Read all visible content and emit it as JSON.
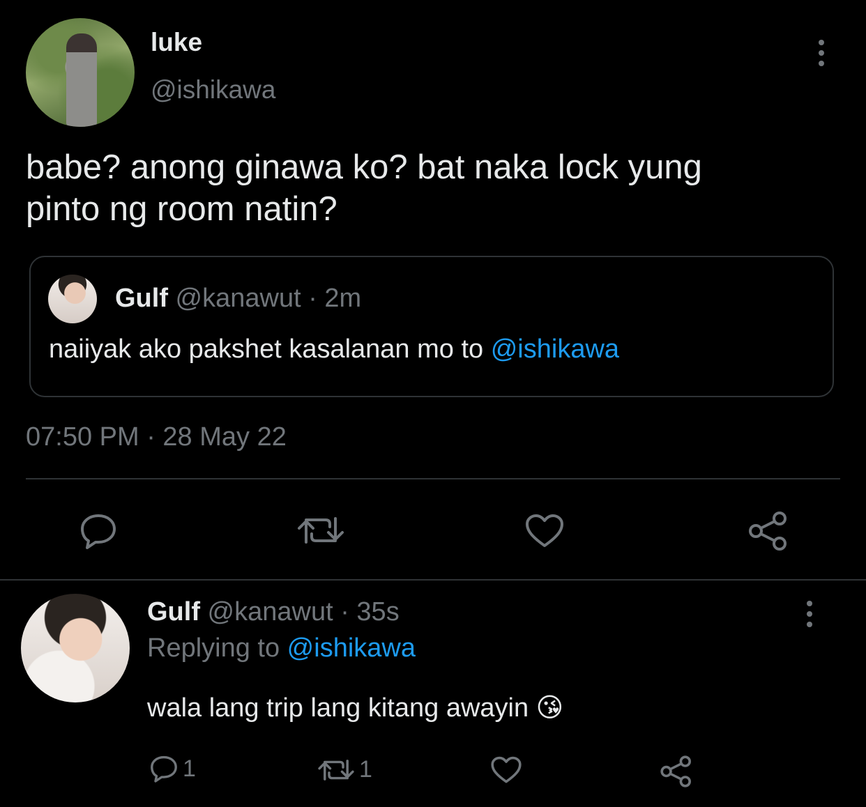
{
  "main_tweet": {
    "display_name": "luke",
    "handle": "@ishikawa",
    "text_line1": "babe? anong ginawa ko? bat naka lock yung",
    "text_line2": "pinto ng room natin?",
    "timestamp": "07:50 PM · 28 May 22"
  },
  "quoted_tweet": {
    "display_name": "Gulf",
    "handle_time": "@kanawut · 2m",
    "text": "naiiyak ako pakshet kasalanan mo to ",
    "mention": "@ishikawa"
  },
  "reply_tweet": {
    "display_name": "Gulf",
    "handle_time": "@kanawut · 35s",
    "replying_prefix": "Replying to ",
    "replying_mention": "@ishikawa",
    "text": "wala lang trip lang kitang awayin",
    "emoji": "😘",
    "reply_count": "1",
    "retweet_count": "1"
  },
  "icons": {
    "reply": "reply-icon",
    "retweet": "retweet-icon",
    "like": "heart-icon",
    "share": "share-icon",
    "more": "more-icon"
  },
  "colors": {
    "background": "#000000",
    "text": "#e7e9ea",
    "muted": "#71767b",
    "link": "#1d9bf0",
    "border": "#2f3336"
  }
}
